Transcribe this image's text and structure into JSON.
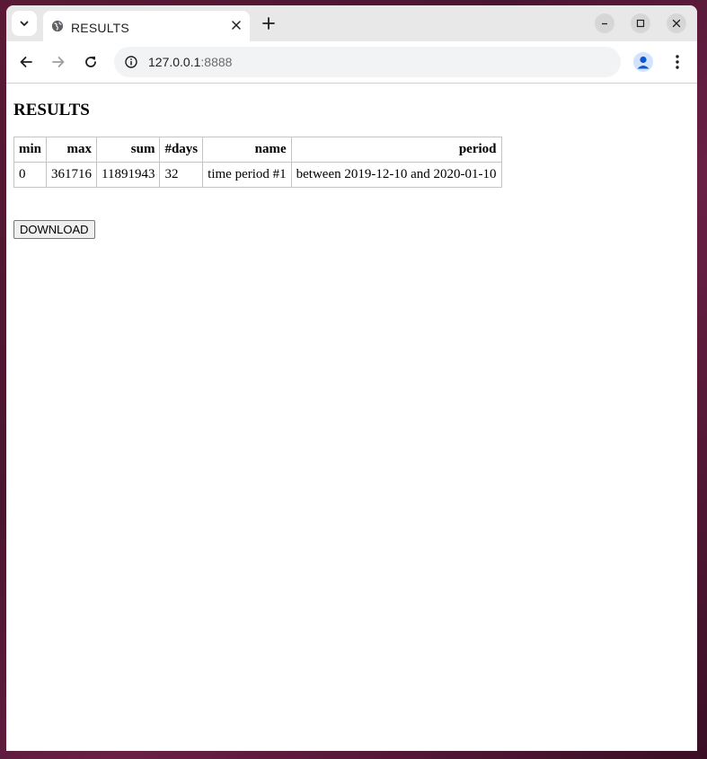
{
  "browser": {
    "tab_title": "RESULTS",
    "url_host": "127.0.0.1",
    "url_port": ":8888"
  },
  "page": {
    "heading": "RESULTS",
    "table": {
      "headers": [
        "min",
        "max",
        "sum",
        "#days",
        "name",
        "period"
      ],
      "rows": [
        [
          "0",
          "361716",
          "11891943",
          "32",
          "time period #1",
          "between 2019-12-10 and 2020-01-10"
        ]
      ]
    },
    "download_label": "DOWNLOAD"
  },
  "icons": {
    "tab_search": "chevron-down-icon",
    "favicon": "globe-icon",
    "tab_close": "close-icon",
    "new_tab": "plus-icon",
    "minimize": "minimize-icon",
    "maximize": "maximize-icon",
    "close_window": "close-icon",
    "back": "arrow-left-icon",
    "forward": "arrow-right-icon",
    "reload": "reload-icon",
    "site_info": "info-icon",
    "bookmark": "star-icon",
    "profile": "profile-icon",
    "menu": "kebab-menu-icon"
  },
  "colors": {
    "desktop": "#5a1a35",
    "tabstrip": "#e8e8e8",
    "omnibox": "#f1f3f4",
    "profile_accent": "#0b57d0"
  }
}
